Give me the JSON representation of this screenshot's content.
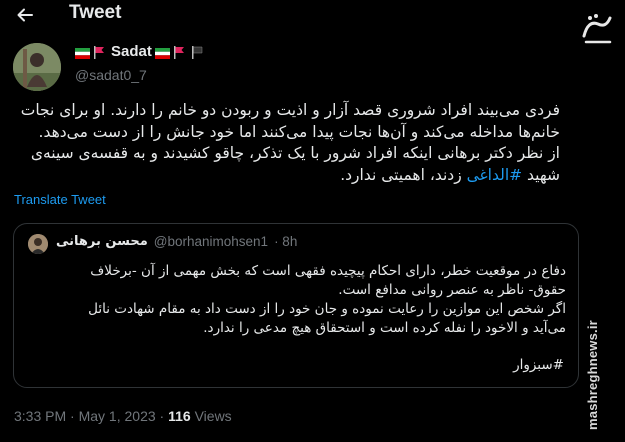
{
  "header": {
    "title": "Tweet",
    "back_icon": "back-arrow-icon"
  },
  "author": {
    "name": "Sadat",
    "handle": "@sadat0_7",
    "name_emojis": [
      "iran-flag",
      "red-flag",
      "iran-flag",
      "red-flag",
      "black-flag"
    ]
  },
  "tweet": {
    "lines": [
      "فردی می‌بیند افراد شروری قصد آزار و اذیت و ربودن دو خانم را دارند. او برای نجات",
      "خانم‌ها مداخله می‌کند و آن‌ها نجات پیدا می‌کنند اما خود جانش را از دست می‌دهد.",
      "از نظر دکتر برهانی اینکه افراد شرور با یک تذکر، چاقو کشیدند و به قفسه‌ی سینه‌ی"
    ],
    "last_line_prefix": "شهید",
    "hashtag": "#الداغی",
    "last_line_suffix": "زدند، اهمیتی ندارد."
  },
  "translate_label": "Translate Tweet",
  "quote": {
    "name": "محسن برهانی",
    "handle": "@borhanimohsen1",
    "time": "· 8h",
    "lines": [
      "دفاع در موقعیت خطر، دارای احکام پیچیده فقهی است که بخش مهمی از آن -برخلاف",
      "حقوق- ناظر به عنصر روانی مدافع است.",
      "اگر شخص این موازین را رعایت نموده و جان خود را از دست داد به مقام شهادت نائل",
      "می‌آید و الاخود را نفله کرده است و استحقاق هیچ مدعی را ندارد."
    ],
    "hashtag": "#سبزوار"
  },
  "meta": {
    "time": "3:33 PM",
    "separator": " · ",
    "date": "May 1, 2023",
    "views_count": "116",
    "views_label": "Views"
  },
  "watermark": {
    "logo_text": "مشرق",
    "site": "mashreghnews.ir"
  },
  "colors": {
    "background": "#000000",
    "text": "#e7e9ea",
    "muted": "#71767b",
    "link": "#1d9bf0",
    "border": "#2f3336"
  }
}
